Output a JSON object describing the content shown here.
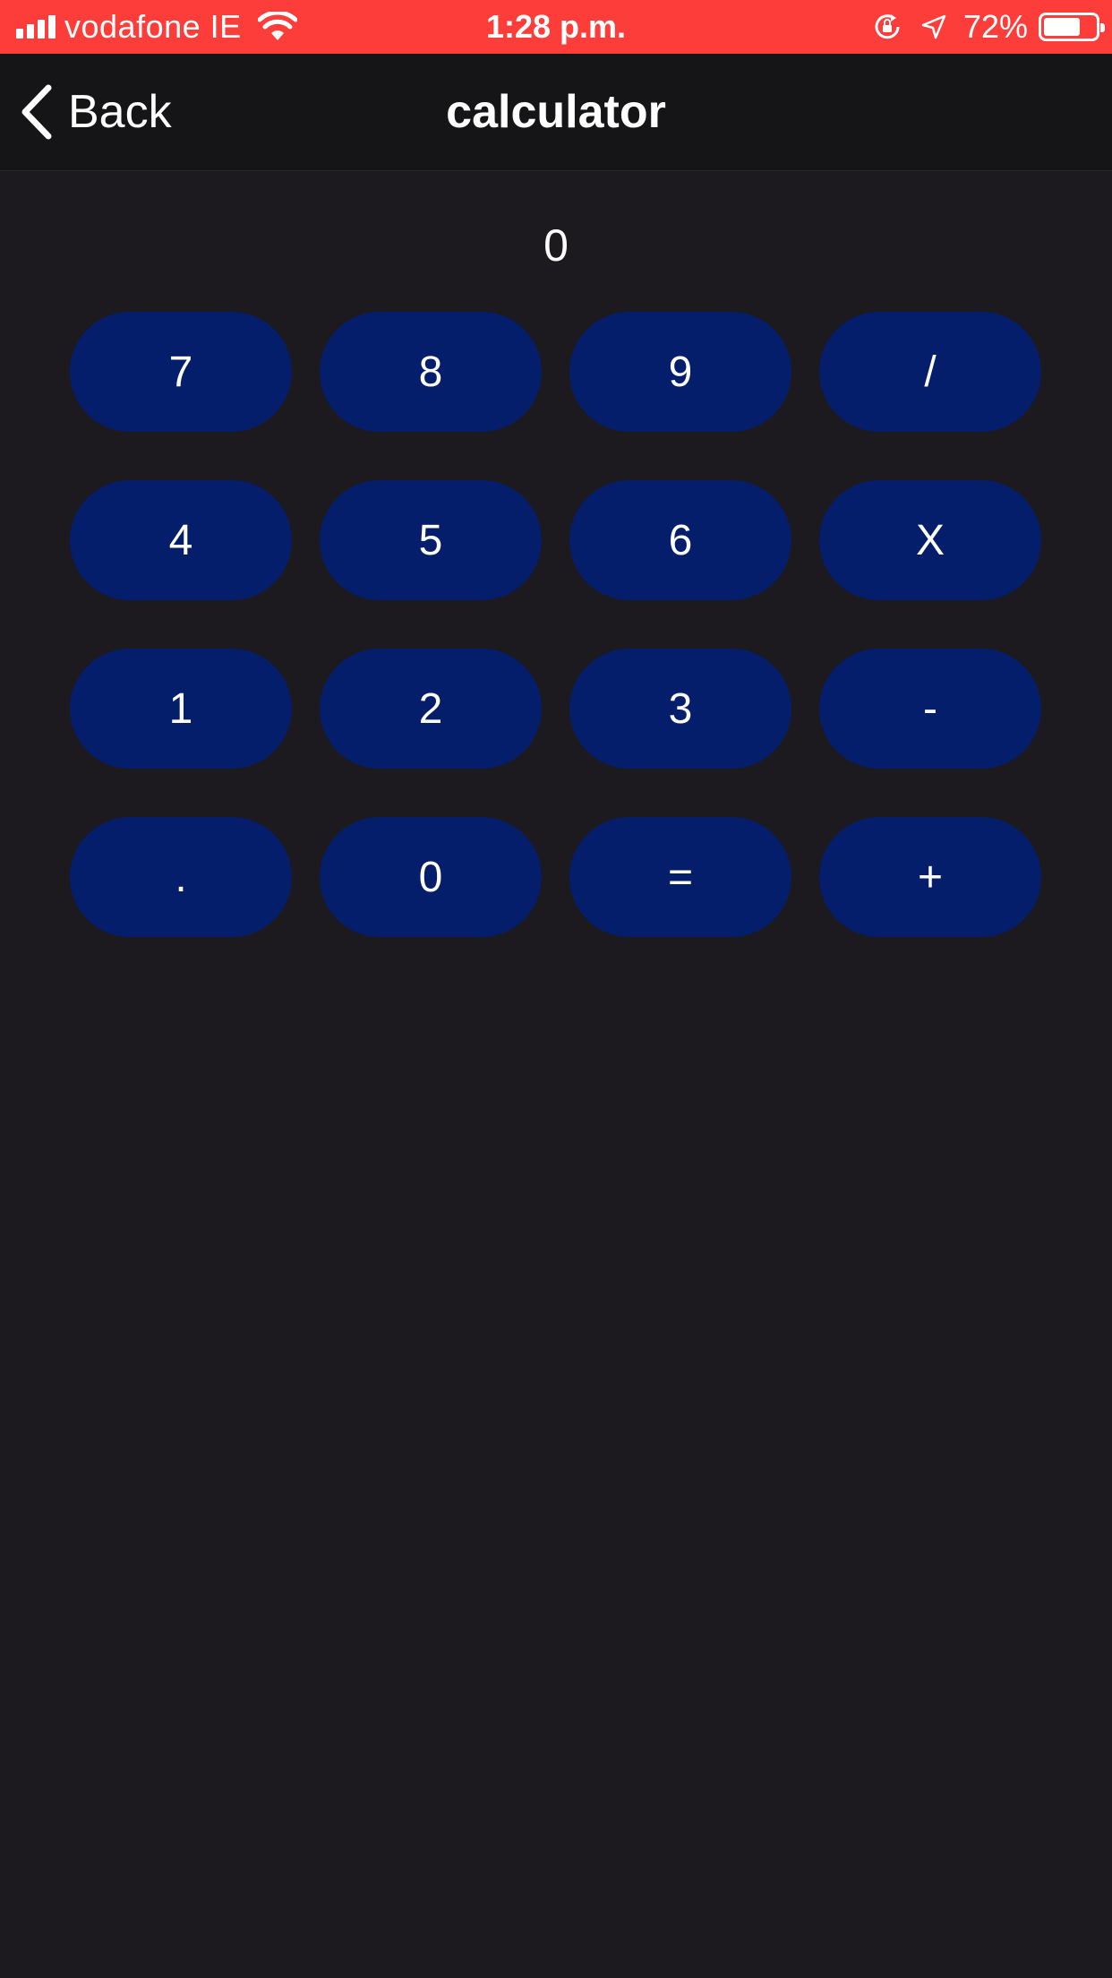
{
  "status_bar": {
    "carrier": "vodafone IE",
    "time": "1:28 p.m.",
    "battery_percent": "72%",
    "battery_level": 0.72,
    "signal_bars": 4,
    "icons": [
      "signal-icon",
      "wifi-icon",
      "rotation-lock-icon",
      "location-arrow-icon",
      "battery-icon"
    ],
    "background_color": "#fc3d39"
  },
  "nav": {
    "back_label": "Back",
    "title": "calculator"
  },
  "display": {
    "value": "0"
  },
  "keypad": {
    "key_color": "#051e6b",
    "keys": [
      {
        "label": "7",
        "name": "key-7"
      },
      {
        "label": "8",
        "name": "key-8"
      },
      {
        "label": "9",
        "name": "key-9"
      },
      {
        "label": "/",
        "name": "key-divide"
      },
      {
        "label": "4",
        "name": "key-4"
      },
      {
        "label": "5",
        "name": "key-5"
      },
      {
        "label": "6",
        "name": "key-6"
      },
      {
        "label": "X",
        "name": "key-multiply"
      },
      {
        "label": "1",
        "name": "key-1"
      },
      {
        "label": "2",
        "name": "key-2"
      },
      {
        "label": "3",
        "name": "key-3"
      },
      {
        "label": "-",
        "name": "key-subtract"
      },
      {
        "label": ".",
        "name": "key-decimal"
      },
      {
        "label": "0",
        "name": "key-0"
      },
      {
        "label": "=",
        "name": "key-equals"
      },
      {
        "label": "+",
        "name": "key-add"
      }
    ]
  }
}
